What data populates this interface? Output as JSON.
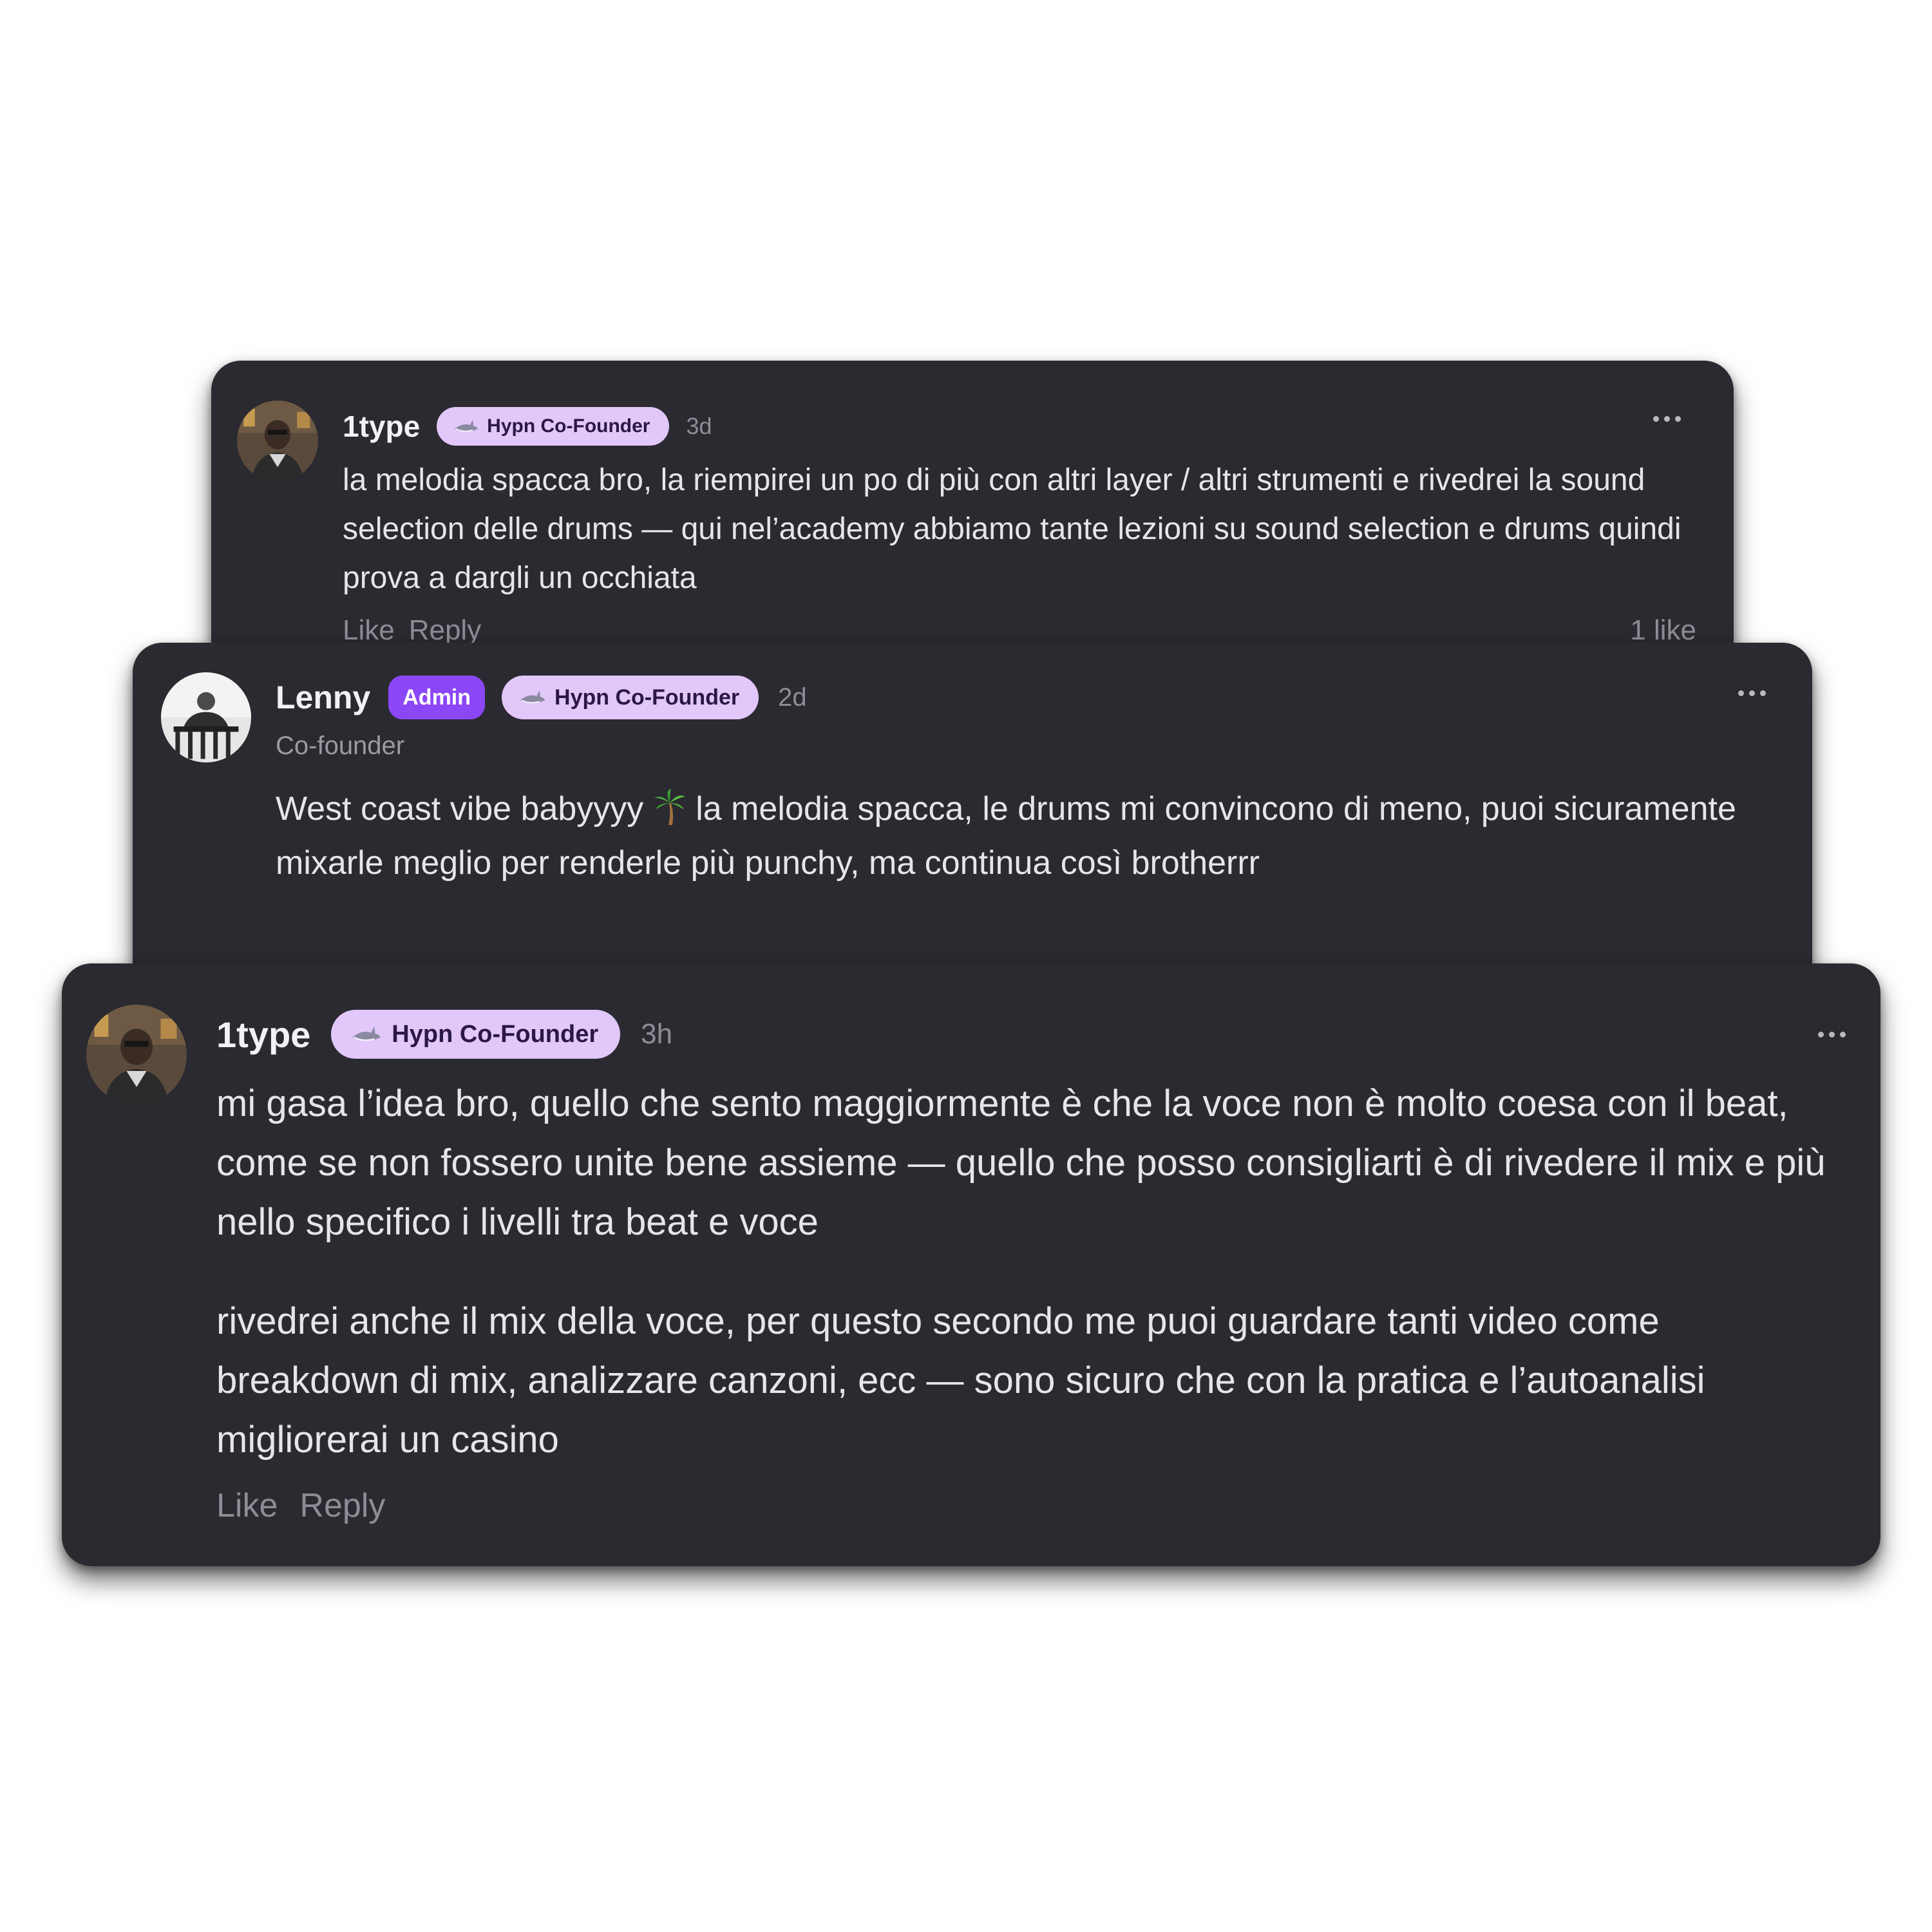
{
  "comments": [
    {
      "username": "1type",
      "role_badge": "Hypn Co-Founder",
      "time": "3d",
      "paragraphs": [
        "la melodia spacca bro, la riempirei un po di più con altri layer / altri strumenti e rivedrei la sound selection delle drums — qui nel’academy abbiamo tante lezioni su sound selection e drums quindi prova a dargli un occhiata"
      ],
      "actions": {
        "like": "Like",
        "reply": "Reply"
      },
      "likes": "1 like"
    },
    {
      "username": "Lenny",
      "admin_badge": "Admin",
      "role_badge": "Hypn Co-Founder",
      "time": "2d",
      "subtitle": "Co-founder",
      "body_before_emoji": "West coast vibe babyyyy ",
      "body_after_emoji": " la melodia spacca, le drums mi convincono di meno, puoi sicuramente mixarle meglio per renderle più punchy, ma continua così brotherrr"
    },
    {
      "username": "1type",
      "role_badge": "Hypn Co-Founder",
      "time": "3h",
      "paragraphs": [
        "mi gasa l’idea bro, quello che sento maggiormente è che la voce non è molto coesa con il beat, come se non fossero unite bene assieme — quello che posso consigliarti è di rivedere il mix e più nello specifico i livelli tra beat e voce",
        "rivedrei anche il mix della voce, per questo secondo me puoi guardare tanti video come breakdown di mix, analizzare canzoni, ecc — sono sicuro che con la pratica e l’autoanalisi migliorerai un casino"
      ],
      "actions": {
        "like": "Like",
        "reply": "Reply"
      }
    }
  ],
  "colors": {
    "card_bg": "#2a2a30",
    "role_badge_bg": "#e2c7fb",
    "admin_badge_bg": "#8b47f6",
    "muted_text": "#8d8d96"
  },
  "icons": [
    "shark-icon",
    "palm-tree-icon",
    "more-options-icon"
  ]
}
